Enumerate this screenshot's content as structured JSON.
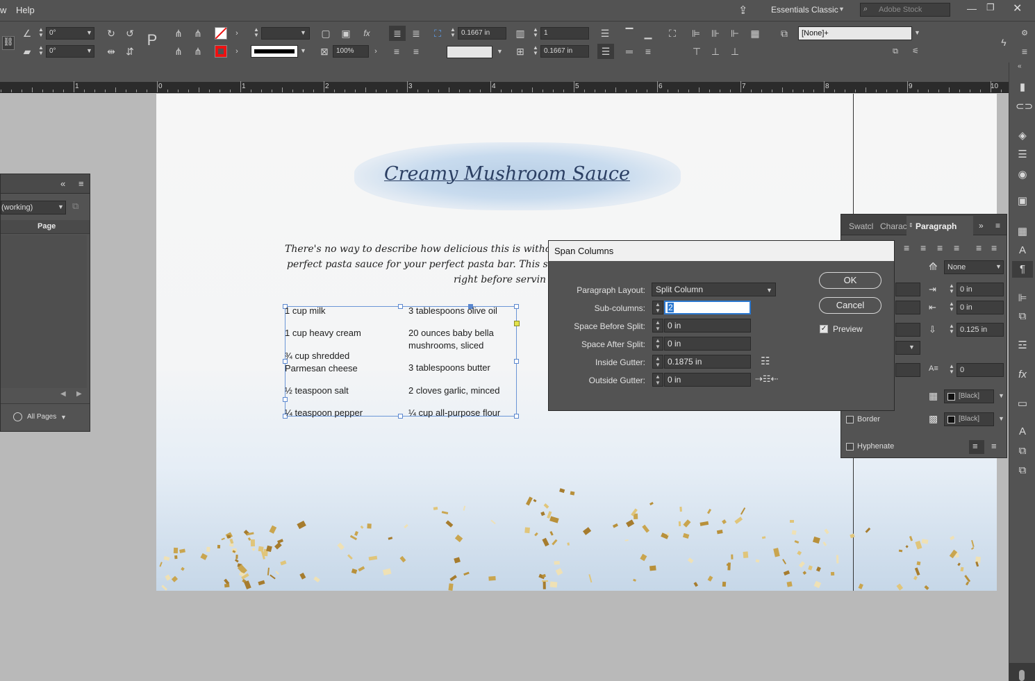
{
  "menubar": {
    "cut_item": "w",
    "help": "Help",
    "workspace": "Essentials Classic",
    "search_placeholder": "Adobe Stock"
  },
  "control": {
    "rotate_angle": "0°",
    "shear_angle": "0°",
    "opacity": "100%",
    "column_width": "0.1667 in",
    "columns": "1",
    "gutter": "0.1667 in",
    "object_style": "[None]+"
  },
  "ruler": {
    "labels": [
      "1",
      "0",
      "1",
      "2",
      "3",
      "4",
      "5",
      "6",
      "7",
      "8",
      "9",
      "10"
    ]
  },
  "document": {
    "title": "Creamy Mushroom Sauce",
    "intro_line1": "There's no way to describe how delicious this is witho",
    "intro_line2": "perfect pasta sauce for your perfect pasta bar. This sa",
    "intro_line3": "right before servin",
    "ingredients_left": [
      "1 cup milk",
      "1 cup heavy cream",
      "¾ cup shredded\nParmesan cheese",
      "½ teaspoon salt",
      "¼ teaspoon pepper"
    ],
    "ingredients_right": [
      "3 tablespoons olive oil",
      "20 ounces baby bella\nmushrooms, sliced",
      "3 tablespoons butter",
      "2 cloves garlic, minced",
      "¼ cup all-purpose flour"
    ]
  },
  "pages_panel": {
    "document_value": "(working)",
    "column_header": "Page",
    "footer_dropdown": "All Pages"
  },
  "dialog": {
    "title": "Span Columns",
    "paragraph_layout_label": "Paragraph Layout:",
    "paragraph_layout_value": "Split Column",
    "sub_columns_label": "Sub-columns:",
    "sub_columns_value": "2",
    "space_before_label": "Space Before Split:",
    "space_before_value": "0 in",
    "space_after_label": "Space After Split:",
    "space_after_value": "0 in",
    "inside_gutter_label": "Inside Gutter:",
    "inside_gutter_value": "0.1875 in",
    "outside_gutter_label": "Outside Gutter:",
    "outside_gutter_value": "0 in",
    "ok": "OK",
    "cancel": "Cancel",
    "preview_label": "Preview",
    "preview_checked": true
  },
  "paragraph_panel": {
    "tabs": [
      "Swatcl",
      "Charac",
      "Paragraph"
    ],
    "dropcap_value": "None",
    "right_indent": "0 in",
    "last_line_indent": "0 in",
    "space_after": "0.125 in",
    "dropcap_chars": "0",
    "shading_swatch": "[Black]",
    "border_swatch": "[Black]",
    "border_label": "Border",
    "hyphenate_label": "Hyphenate"
  },
  "colors": {
    "app_bg": "#535353",
    "canvas_bg": "#b9b9b9",
    "title_blue": "#2b3f63",
    "frame_blue": "#6a95d6",
    "accent_focus": "#2b78d0"
  }
}
